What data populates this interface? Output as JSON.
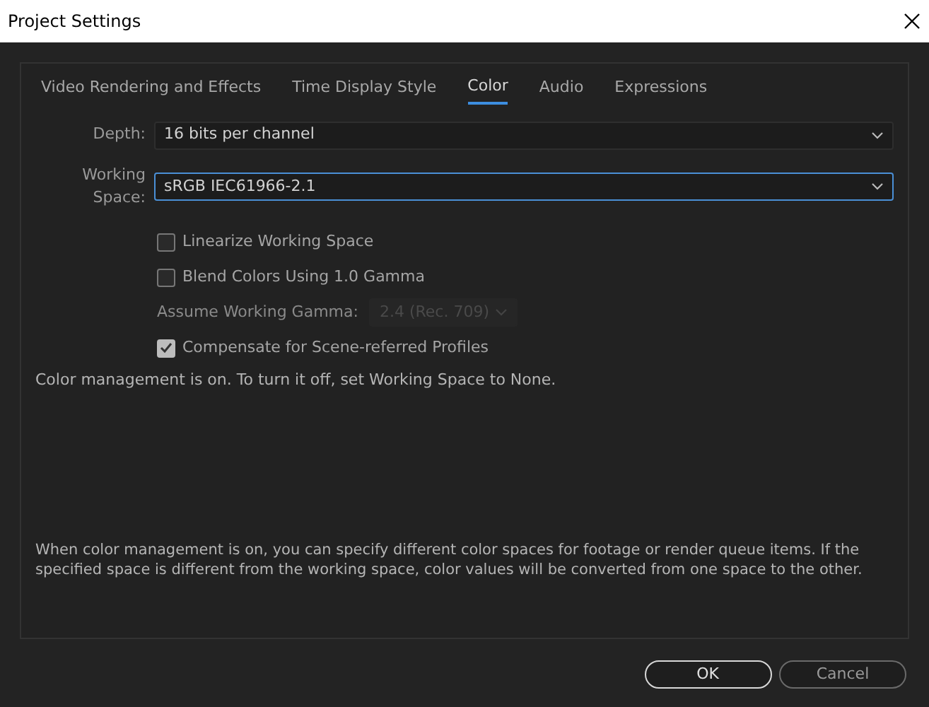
{
  "window": {
    "title": "Project Settings"
  },
  "tabs": [
    {
      "label": "Video Rendering and Effects",
      "selected": false
    },
    {
      "label": "Time Display Style",
      "selected": false
    },
    {
      "label": "Color",
      "selected": true
    },
    {
      "label": "Audio",
      "selected": false
    },
    {
      "label": "Expressions",
      "selected": false
    }
  ],
  "fields": [
    {
      "label": "Depth:",
      "value": "16 bits per channel",
      "focused": false
    },
    {
      "label": "Working Space:",
      "value": "sRGB IEC61966-2.1",
      "focused": true
    }
  ],
  "options": [
    {
      "kind": "checkbox",
      "label": "Linearize Working Space",
      "checked": false
    },
    {
      "kind": "checkbox",
      "label": "Blend Colors Using 1.0 Gamma",
      "checked": false
    },
    {
      "kind": "select",
      "label": "Assume Working Gamma:",
      "value": "2.4 (Rec. 709)",
      "disabled": true
    },
    {
      "kind": "checkbox",
      "label": "Compensate for Scene-referred Profiles",
      "checked": true
    }
  ],
  "note": "Color management is on. To turn it off, set Working Space to None.",
  "description": "When color management is on, you can specify different color spaces for footage or render queue items. If the specified space is different from the working space, color values will be converted from one space to the other.",
  "buttons": [
    {
      "label": "OK",
      "kind": "primary"
    },
    {
      "label": "Cancel",
      "kind": "secondary"
    }
  ]
}
